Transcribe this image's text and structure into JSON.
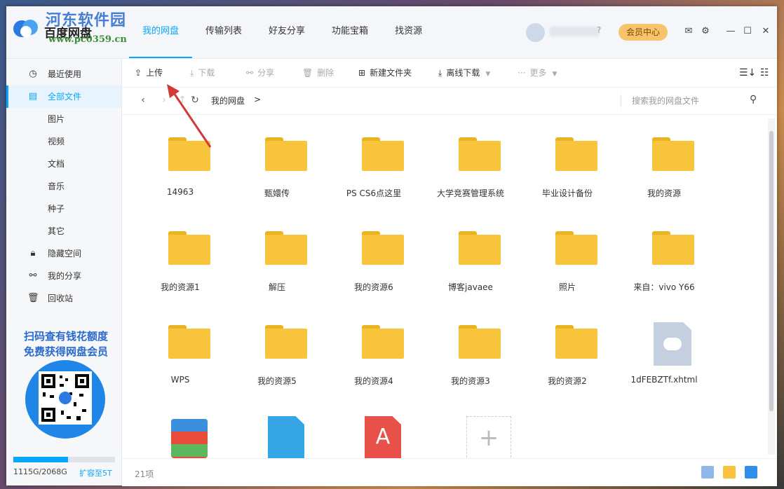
{
  "app": {
    "name": "百度网盘",
    "watermark": "河东软件园",
    "watermark_url": "www.pc0359.cn"
  },
  "nav_tabs": [
    {
      "label": "我的网盘",
      "active": true
    },
    {
      "label": "传输列表"
    },
    {
      "label": "好友分享"
    },
    {
      "label": "功能宝箱"
    },
    {
      "label": "找资源"
    }
  ],
  "header": {
    "help": "?",
    "vip_label": "会员中心"
  },
  "sidebar": {
    "items": [
      {
        "label": "最近使用",
        "icon": "clock-icon"
      },
      {
        "label": "全部文件",
        "icon": "file-icon",
        "active": true
      },
      {
        "label": "图片"
      },
      {
        "label": "视频"
      },
      {
        "label": "文档"
      },
      {
        "label": "音乐"
      },
      {
        "label": "种子"
      },
      {
        "label": "其它"
      },
      {
        "label": "隐藏空间",
        "icon": "lock-icon"
      },
      {
        "label": "我的分享",
        "icon": "share-icon"
      },
      {
        "label": "回收站",
        "icon": "trash-icon"
      }
    ],
    "promo_line1": "扫码查有钱花额度",
    "promo_line2": "免费获得网盘会员",
    "storage_text": "1115G/2068G",
    "storage_fraction": 0.54,
    "expand_label": "扩容至5T"
  },
  "toolbar": {
    "upload": "上传",
    "download": "下载",
    "share": "分享",
    "delete": "删除",
    "new_folder": "新建文件夹",
    "offline_download": "离线下载",
    "more": "更多"
  },
  "address": {
    "crumb": "我的网盘",
    "sep": ">",
    "search_placeholder": "搜索我的网盘文件"
  },
  "files": [
    {
      "name": "14963",
      "type": "folder"
    },
    {
      "name": "甄嬛传",
      "type": "folder"
    },
    {
      "name": "PS CS6点这里",
      "type": "folder"
    },
    {
      "name": "大学竞赛管理系统",
      "type": "folder"
    },
    {
      "name": "毕业设计备份",
      "type": "folder"
    },
    {
      "name": "我的资源",
      "type": "folder"
    },
    {
      "name": "我的资源1",
      "type": "folder"
    },
    {
      "name": "解压",
      "type": "folder"
    },
    {
      "name": "我的资源6",
      "type": "folder"
    },
    {
      "name": "博客javaee",
      "type": "folder"
    },
    {
      "name": "照片",
      "type": "folder"
    },
    {
      "name": "来自：vivo Y66",
      "type": "folder"
    },
    {
      "name": "WPS",
      "type": "folder"
    },
    {
      "name": "我的资源5",
      "type": "folder"
    },
    {
      "name": "我的资源4",
      "type": "folder"
    },
    {
      "name": "我的资源3",
      "type": "folder"
    },
    {
      "name": "我的资源2",
      "type": "folder"
    },
    {
      "name": "1dFEBZTf.xhtml",
      "type": "doc"
    },
    {
      "name": "",
      "type": "rar"
    },
    {
      "name": "",
      "type": "disk"
    },
    {
      "name": "",
      "type": "pdf"
    },
    {
      "name": "",
      "type": "add"
    }
  ],
  "status": {
    "count": "21项"
  },
  "colors": {
    "accent": "#06a7ff",
    "folder": "#f7c43b",
    "vip": "#f7c46b"
  }
}
